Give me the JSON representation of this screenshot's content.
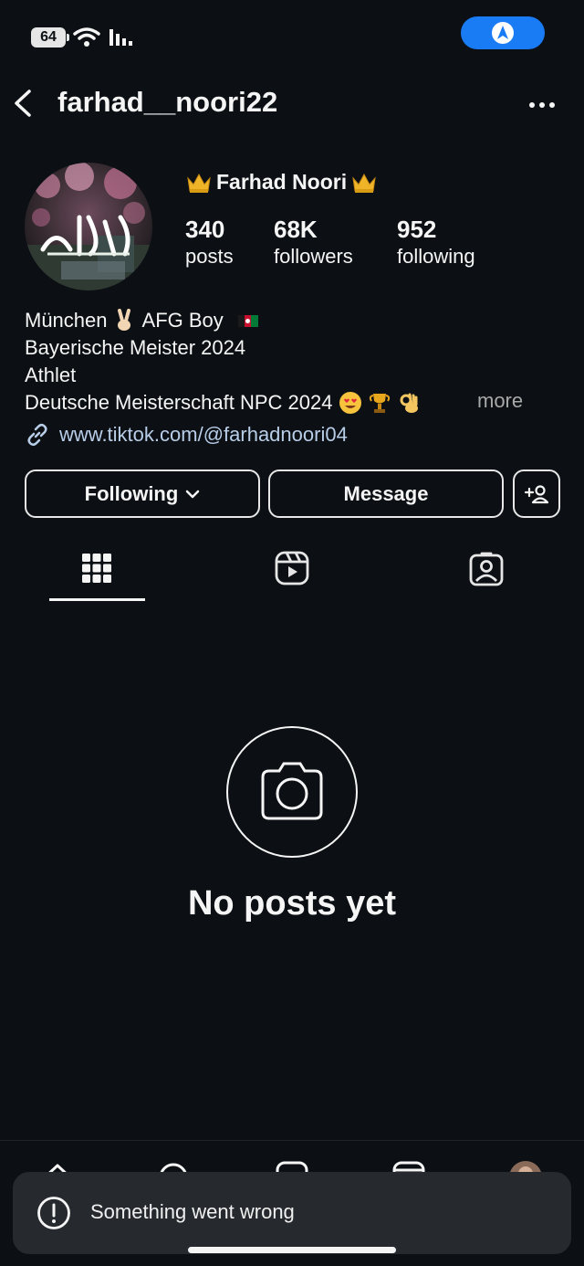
{
  "status_bar": {
    "battery": "64"
  },
  "header": {
    "username": "farhad__noori22"
  },
  "profile": {
    "display_name": "Farhad Noori",
    "stats": [
      {
        "value": "340",
        "label": "posts"
      },
      {
        "value": "68K",
        "label": "followers"
      },
      {
        "value": "952",
        "label": "following"
      }
    ],
    "bio": {
      "line1_a": "München",
      "line1_b": "AFG Boy",
      "line2": "Bayerische Meister 2024",
      "line3": "Athlet",
      "line4": "Deutsche Meisterschaft NPC 2024",
      "more": "more"
    },
    "link": "www.tiktok.com/@farhadnoori04"
  },
  "actions": {
    "following_label": "Following",
    "message_label": "Message"
  },
  "tabs": [
    {
      "icon": "grid-icon",
      "active": true
    },
    {
      "icon": "reels-icon",
      "active": false
    },
    {
      "icon": "tagged-icon",
      "active": false
    }
  ],
  "empty_state": {
    "text": "No posts yet"
  },
  "toast": {
    "text": "Something went wrong"
  },
  "colors": {
    "background": "#0c1014",
    "accent": "#1a7cf5",
    "link": "#b8cde8",
    "toast": "#262a2f"
  }
}
